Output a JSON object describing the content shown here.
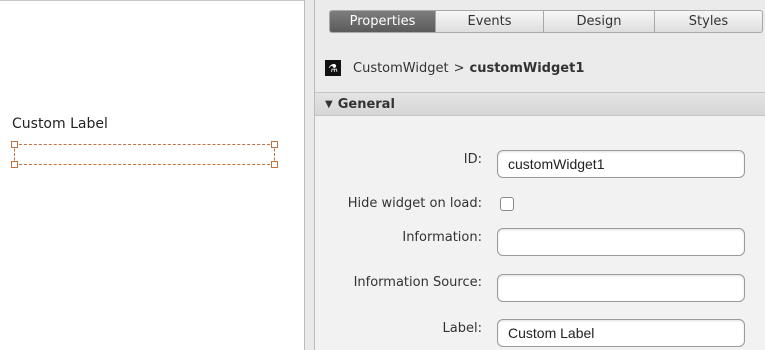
{
  "canvas": {
    "widget_label": "Custom Label"
  },
  "tabs": [
    {
      "label": "Properties",
      "active": true
    },
    {
      "label": "Events",
      "active": false
    },
    {
      "label": "Design",
      "active": false
    },
    {
      "label": "Styles",
      "active": false
    }
  ],
  "breadcrumb": {
    "icon": "flask-icon",
    "widget_type": "CustomWidget",
    "separator": ">",
    "widget_id": "customWidget1"
  },
  "section": {
    "title": "General",
    "expanded_icon": "triangle-down-icon"
  },
  "form": {
    "id_label": "ID:",
    "id_value": "customWidget1",
    "hide_label": "Hide widget on load:",
    "hide_checked": false,
    "information_label": "Information:",
    "information_value": "",
    "information_source_label": "Information Source:",
    "information_source_value": "",
    "label_label": "Label:",
    "label_value": "Custom Label"
  },
  "colors": {
    "selection": "#c0733f",
    "active_tab": "#6b6b6b"
  }
}
